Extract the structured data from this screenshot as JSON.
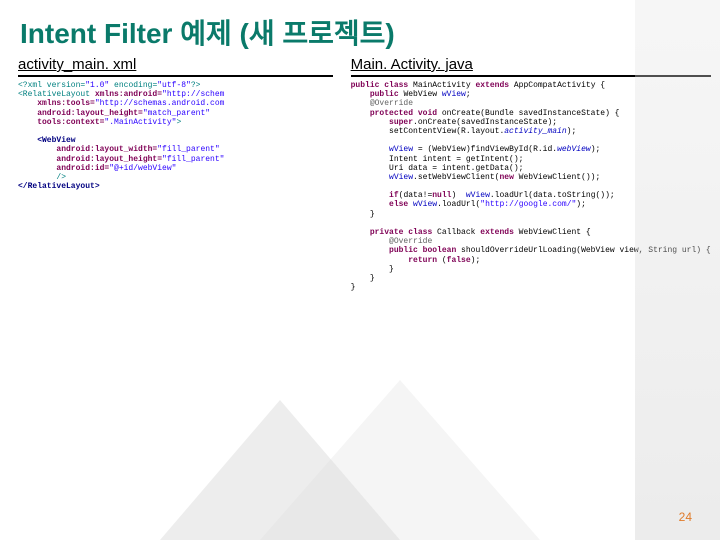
{
  "title": "Intent Filter 예제 (새 프로젝트)",
  "leftHeader": "activity_main. xml",
  "rightHeader": "Main. Activity. java",
  "pageNum": "24",
  "xml": {
    "l1a": "<?xml version=",
    "l1b": "\"1.0\"",
    "l1c": " encoding=",
    "l1d": "\"utf-8\"",
    "l1e": "?>",
    "l2a": "<RelativeLayout ",
    "l2b": "xmlns:android=",
    "l2c": "\"http://schem",
    "l3a": "    xmlns:tools=",
    "l3b": "\"http://schemas.android.com",
    "l4a": "    android:layout_height=",
    "l4b": "\"match_parent\"",
    "l5a": "    tools:context=",
    "l5b": "\".MainActivity\"",
    "l5c": ">",
    "l6": "",
    "l7a": "    <WebView",
    "l8a": "        android:layout_width=",
    "l8b": "\"fill_parent\"",
    "l9a": "        android:layout_height=",
    "l9b": "\"fill_parent\"",
    "l10a": "        android:id=",
    "l10b": "\"@+id/webView\"",
    "l11": "        />",
    "l12a": "</RelativeLayout>"
  },
  "java": {
    "l1a": "public class ",
    "l1b": "MainActivity ",
    "l1c": "extends ",
    "l1d": "AppCompatActivity {",
    "l2a": "    public ",
    "l2b": "WebView ",
    "l2c": "wView",
    "l2d": ";",
    "l3a": "    @Override",
    "l4a": "    protected void ",
    "l4b": "onCreate(Bundle savedInstanceState) {",
    "l5a": "        super",
    "l5b": ".onCreate(savedInstanceState);",
    "l6a": "        setContentView(R.layout.",
    "l6b": "activity_main",
    "l6c": ");",
    "l7": "",
    "l8a": "        wView",
    "l8b": " = (WebView)findViewById(R.id.",
    "l8c": "webView",
    "l8d": ");",
    "l9a": "        Intent intent = getIntent();",
    "l10a": "        Uri data = intent.getData();",
    "l11a": "        wView",
    "l11b": ".setWebViewClient(",
    "l11c": "new ",
    "l11d": "WebViewClient());",
    "l12": "",
    "l13a": "        if",
    "l13b": "(data!=",
    "l13c": "null",
    "l13d": ")  ",
    "l13e": "wView",
    "l13f": ".loadUrl(data.toString());",
    "l14a": "        else ",
    "l14b": "wView",
    "l14c": ".loadUrl(",
    "l14d": "\"http://google.com/\"",
    "l14e": ");",
    "l15": "    }",
    "l16": "",
    "l17a": "    private class ",
    "l17b": "Callback ",
    "l17c": "extends ",
    "l17d": "WebViewClient {",
    "l18a": "        @Override",
    "l19a": "        public boolean ",
    "l19b": "shouldOverrideUrlLoading(WebView view, String url) {",
    "l20a": "            return ",
    "l20b": "(",
    "l20c": "false",
    "l20d": ");",
    "l21": "        }",
    "l22": "    }",
    "l23": "}"
  }
}
